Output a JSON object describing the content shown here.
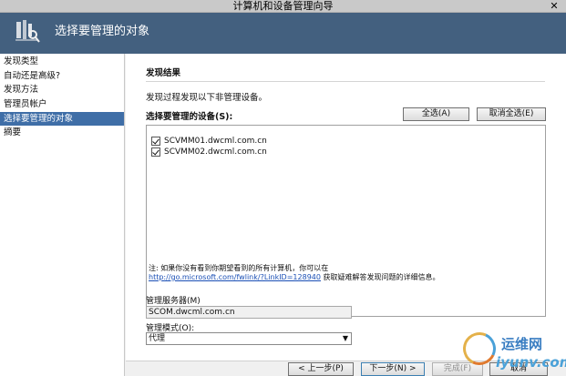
{
  "window": {
    "title": "计算机和设备管理向导",
    "close_glyph": "✕"
  },
  "header": {
    "title": "选择要管理的对象",
    "icon": "wizard-tools-icon"
  },
  "nav": {
    "items": [
      {
        "label": "发现类型",
        "active": false
      },
      {
        "label": "自动还是高级?",
        "active": false
      },
      {
        "label": "发现方法",
        "active": false
      },
      {
        "label": "管理员帐户",
        "active": false
      },
      {
        "label": "选择要管理的对象",
        "active": true
      },
      {
        "label": "摘要",
        "active": false
      }
    ]
  },
  "main": {
    "section_title": "发现结果",
    "description": "发现过程发现以下非管理设备。",
    "devices_label": "选择要管理的设备(S):",
    "select_all_label": "全选(A)",
    "deselect_all_label": "取消全选(E)",
    "devices": [
      {
        "name": "SCVMM01.dwcml.com.cn",
        "checked": true
      },
      {
        "name": "SCVMM02.dwcml.com.cn",
        "checked": true
      }
    ],
    "note_prefix": "注: 如果你没有看到你期望看到的所有计算机，你可以在",
    "note_link": "http://go.microsoft.com/fwlink/?LinkID=128940",
    "note_suffix": " 获取疑难解答发现问题的详细信息。",
    "server_label": "管理服务器(M)",
    "server_value": "SCOM.dwcml.com.cn",
    "mode_label": "管理模式(O):",
    "mode_value": "代理"
  },
  "footer": {
    "prev_label": "< 上一步(P)",
    "next_label": "下一步(N) >",
    "finish_label": "完成(F)",
    "cancel_label": "取消"
  },
  "watermark": {
    "brand": "运维网",
    "url": "iyunv.com"
  }
}
